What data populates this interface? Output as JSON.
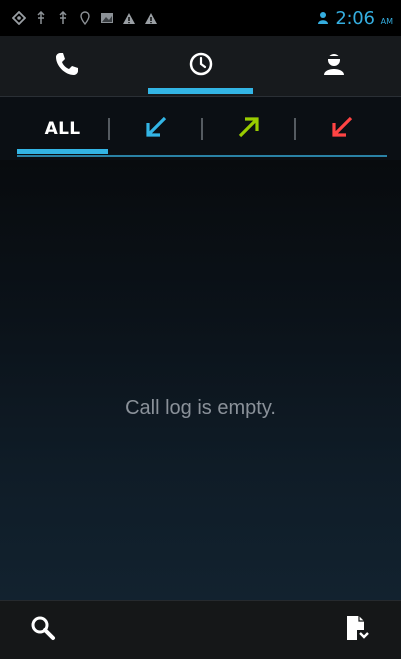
{
  "status_bar": {
    "time": "2:06",
    "ampm": "AM",
    "left_icons": [
      "sync-icon",
      "usb-icon",
      "usb-icon",
      "location-icon",
      "image-icon",
      "warning-icon",
      "warning-icon"
    ],
    "right_icons": [
      "person-icon"
    ],
    "accent_color": "#35aee0"
  },
  "top_tabs": [
    {
      "name": "phone",
      "icon": "phone-icon",
      "selected": false
    },
    {
      "name": "call-log",
      "icon": "clock-icon",
      "selected": true
    },
    {
      "name": "contacts",
      "icon": "contact-icon",
      "selected": false
    }
  ],
  "filter_tabs": [
    {
      "name": "all",
      "label": "ALL",
      "selected": true
    },
    {
      "name": "incoming",
      "icon": "incoming-call-arrow-icon",
      "color": "#33b5e5"
    },
    {
      "name": "outgoing",
      "icon": "outgoing-call-arrow-icon",
      "color": "#99cc00"
    },
    {
      "name": "missed",
      "icon": "missed-call-arrow-icon",
      "color": "#ff4444"
    }
  ],
  "call_log": {
    "empty_message": "Call log is empty."
  },
  "bottom_bar": {
    "left_icon": "search-icon",
    "right_icon": "dialpad-menu-icon"
  },
  "colors": {
    "accent": "#33b5e5",
    "tab_bar_bg": "#171a1d",
    "empty_text": "#8a9199"
  }
}
